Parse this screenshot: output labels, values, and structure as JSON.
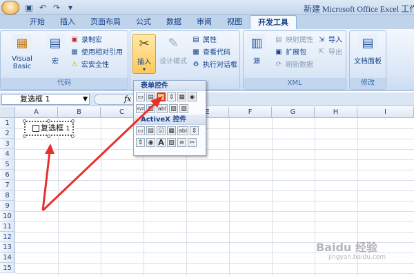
{
  "window": {
    "title": "新建 Microsoft Office Excel 工作"
  },
  "quick_access": [
    "save-icon",
    "undo-icon",
    "redo-icon",
    "customize-icon"
  ],
  "tabs": [
    "开始",
    "插入",
    "页面布局",
    "公式",
    "数据",
    "审阅",
    "视图",
    "开发工具"
  ],
  "active_tab": "开发工具",
  "ribbon": {
    "code_group": {
      "label": "代码",
      "visual_basic": "Visual Basic",
      "macro": "宏",
      "record_macro": "录制宏",
      "use_relative": "使用相对引用",
      "macro_security": "宏安全性"
    },
    "controls_group": {
      "insert": "插入",
      "design_mode": "设计模式",
      "properties": "属性",
      "view_code": "查看代码",
      "run_dialog": "执行对话框"
    },
    "xml_group": {
      "label": "XML",
      "source": "源",
      "map_properties": "映射属性",
      "expansion_pack": "扩展包",
      "refresh_data": "刷新数据",
      "import": "导入",
      "export": "导出"
    },
    "modify_group": {
      "label": "修改",
      "document_panel": "文档面板"
    }
  },
  "formula_bar": {
    "name_box": "复选框 1",
    "fx": "fx"
  },
  "columns": [
    "A",
    "B",
    "C",
    "D",
    "E",
    "F",
    "G",
    "H",
    "I"
  ],
  "rows": [
    "1",
    "2",
    "3",
    "4",
    "5",
    "6",
    "7",
    "8",
    "9",
    "10",
    "11",
    "12",
    "13",
    "14",
    "15"
  ],
  "sheet_checkbox": {
    "label": "复选框",
    "number": "1"
  },
  "insert_gallery": {
    "form_controls_label": "表单控件",
    "activex_label": "ActiveX 控件",
    "form_row1": [
      "▭",
      "▤",
      "☑",
      "⇕",
      "▦",
      "◉"
    ],
    "form_row2": [
      "xyz",
      "▥",
      "abl",
      "▧",
      "▨"
    ],
    "activex_row1": [
      "▭",
      "▤",
      "☑",
      "▦",
      "abl",
      "⇕"
    ],
    "activex_row2": [
      "⇕",
      "◉",
      "A",
      "▨",
      "≡",
      "✂"
    ]
  },
  "watermark": {
    "brand": "Baidu 经验",
    "url": "jingyan.baidu.com"
  },
  "colors": {
    "arrow": "#e8302a",
    "ribbon_text": "#15428b"
  }
}
